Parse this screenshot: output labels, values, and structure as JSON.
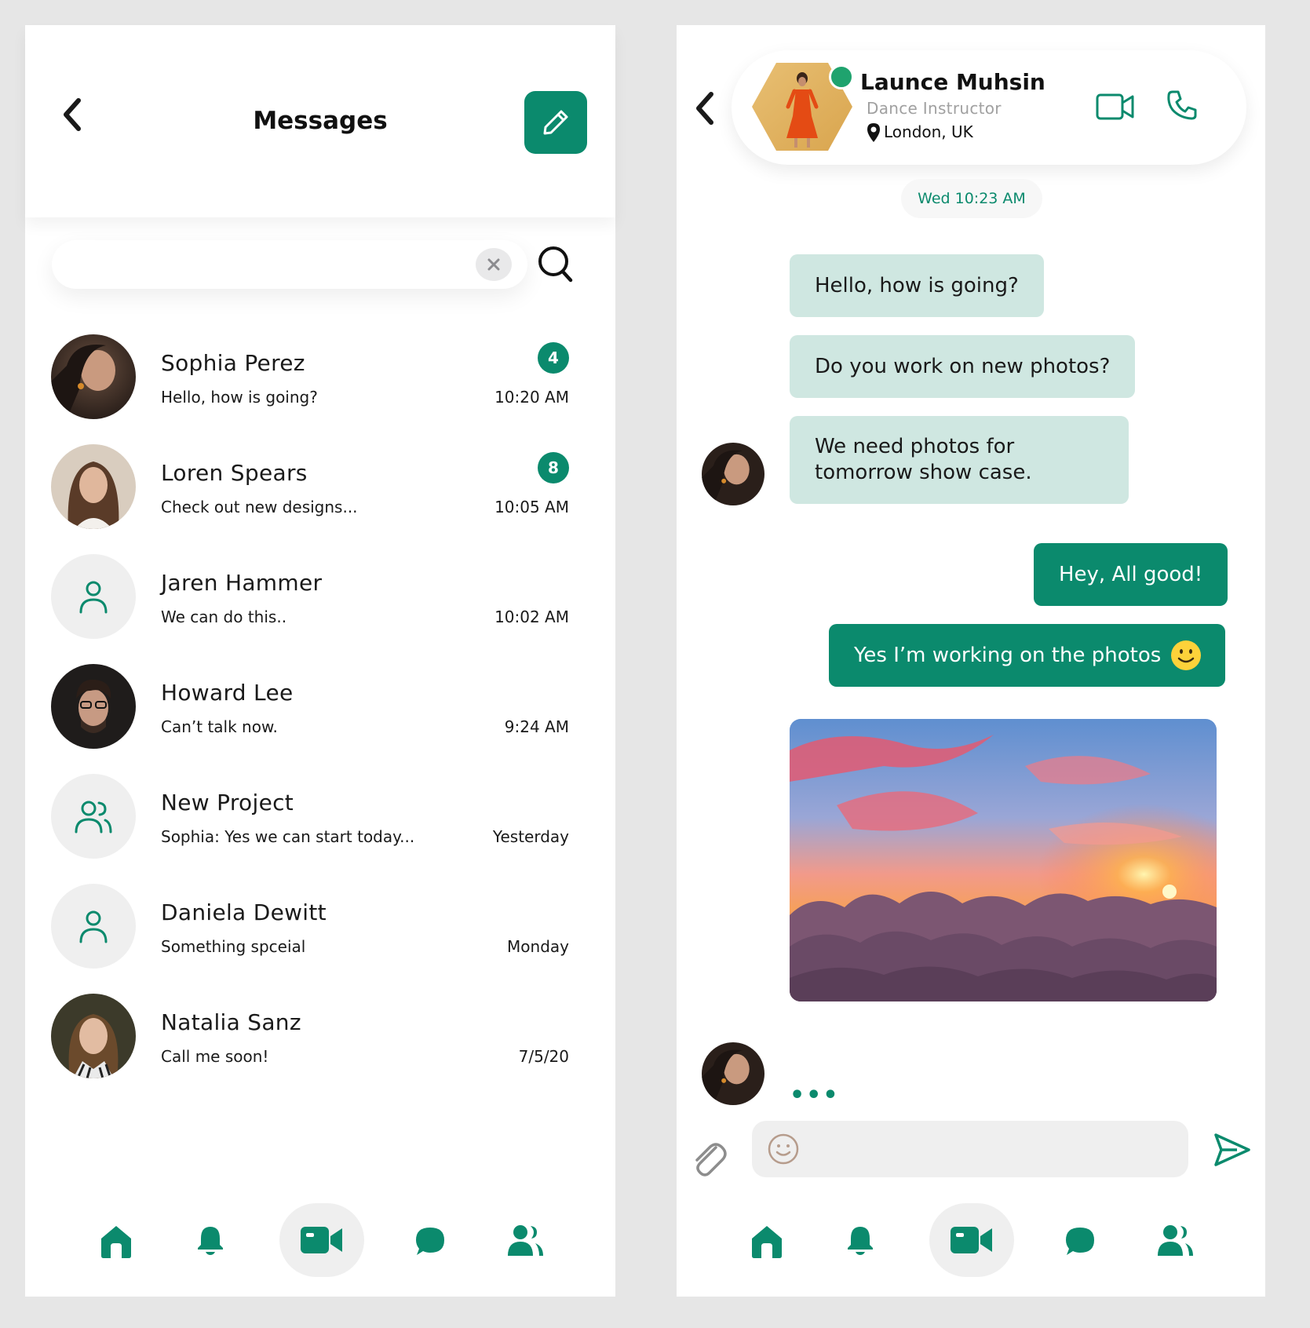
{
  "messages_screen": {
    "title": "Messages",
    "search": {
      "value": "",
      "placeholder": ""
    },
    "conversations": [
      {
        "name": "Sophia Perez",
        "preview": "Hello, how is going?",
        "time": "10:20 AM",
        "unread": "4"
      },
      {
        "name": "Loren Spears",
        "preview": "Check out new designs...",
        "time": "10:05 AM",
        "unread": "8"
      },
      {
        "name": "Jaren Hammer",
        "preview": "We can do this..",
        "time": "10:02 AM"
      },
      {
        "name": "Howard Lee",
        "preview": "Can’t talk now.",
        "time": "9:24 AM"
      },
      {
        "name": "New Project",
        "preview": "Sophia: Yes we can start today...",
        "time": "Yesterday"
      },
      {
        "name": "Daniela Dewitt",
        "preview": "Something spceial",
        "time": "Monday"
      },
      {
        "name": "Natalia Sanz",
        "preview": "Call me soon!",
        "time": "7/5/20"
      }
    ],
    "nav": [
      "home-icon",
      "bell-icon",
      "video-camera-icon",
      "chat-bubble-icon",
      "contacts-icon"
    ]
  },
  "chat_screen": {
    "contact": {
      "name": "Launce Muhsin",
      "role": "Dance Instructor",
      "location": "London, UK",
      "online": true
    },
    "date_chip": "Wed 10:23 AM",
    "messages": [
      {
        "direction": "in",
        "text": "Hello, how is going?"
      },
      {
        "direction": "in",
        "text": "Do you work on new photos?"
      },
      {
        "direction": "in",
        "text": "We need photos for tomorrow show case."
      },
      {
        "direction": "out",
        "text": "Hey, All good!"
      },
      {
        "direction": "out",
        "text": "Yes I’m working on the photos",
        "emoji": "smiley-emoji"
      },
      {
        "direction": "out",
        "type": "image",
        "content": "sunset-clouds-photo"
      }
    ],
    "typing_indicator": "•••",
    "composer": {
      "value": "",
      "placeholder": ""
    }
  },
  "colors": {
    "accent": "#0b8a6d",
    "bubble_in": "#cfe7e1",
    "page_bg": "#e6e6e6",
    "muted": "#a0a0a0",
    "online": "#1fa36e"
  }
}
